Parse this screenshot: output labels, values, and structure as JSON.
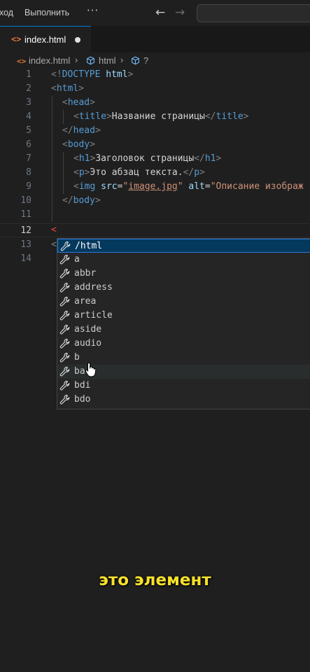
{
  "titlebar": {
    "menu_go": "ход",
    "menu_run": "Выполнить",
    "more": "···",
    "back_arrow": "←",
    "forward_arrow": "→"
  },
  "tab": {
    "icon": "<>",
    "label": "index.html"
  },
  "breadcrumb": {
    "file_icon": "<>",
    "file": "index.html",
    "sep1": "›",
    "item_html": "html",
    "sep2": "›",
    "item_unknown": "?"
  },
  "editor": {
    "line_numbers": [
      "1",
      "2",
      "3",
      "4",
      "5",
      "6",
      "7",
      "8",
      "9",
      "10",
      "11",
      "12",
      "13",
      "14"
    ],
    "l1_open": "<!",
    "l1_doctype": "DOCTYPE",
    "l1_html": " html",
    "l1_close": ">",
    "l2_open": "<",
    "l2_tag": "html",
    "l2_close": ">",
    "l3_open": "<",
    "l3_tag": "head",
    "l3_close": ">",
    "l4_open": "<",
    "l4_tag": "title",
    "l4_close": ">",
    "l4_text": "Название страницы",
    "l4_open2": "</",
    "l4_tag2": "title",
    "l4_close2": ">",
    "l5_open": "</",
    "l5_tag": "head",
    "l5_close": ">",
    "l6_open": "<",
    "l6_tag": "body",
    "l6_close": ">",
    "l7_open": "<",
    "l7_tag": "h1",
    "l7_close": ">",
    "l7_text": "Заголовок страницы",
    "l7_open2": "</",
    "l7_tag2": "h1",
    "l7_close2": ">",
    "l8_open": "<",
    "l8_tag": "p",
    "l8_close": ">",
    "l8_text": "Это абзац текста.",
    "l8_open2": "</",
    "l8_tag2": "p",
    "l8_close2": ">",
    "l9_open": "<",
    "l9_tag": "img",
    "l9_attr1": " src",
    "l9_eq1": "=",
    "l9_q1": "\"",
    "l9_val1": "image.jpg",
    "l9_q2": "\"",
    "l9_attr2": " alt",
    "l9_eq2": "=",
    "l9_val2": "\"Описание изображ",
    "l10_open": "</",
    "l10_tag": "body",
    "l10_close": ">",
    "l12_text": "<",
    "l13_text": "<"
  },
  "suggestions": [
    "/html",
    "a",
    "abbr",
    "address",
    "area",
    "article",
    "aside",
    "audio",
    "b",
    "base",
    "bdi",
    "bdo"
  ],
  "suggestion_visible_labels": [
    "/html",
    "a",
    "abbr",
    "address",
    "area",
    "article",
    "aside",
    "audio",
    "b",
    "ba",
    "bdi",
    "bdo"
  ],
  "caption": "это элемент",
  "colors": {
    "background": "#1f1f1f",
    "tag": "#569cd6",
    "string": "#ce9178",
    "attribute": "#9cdcfe",
    "selection": "#04395e",
    "caption": "#f7e12b"
  }
}
